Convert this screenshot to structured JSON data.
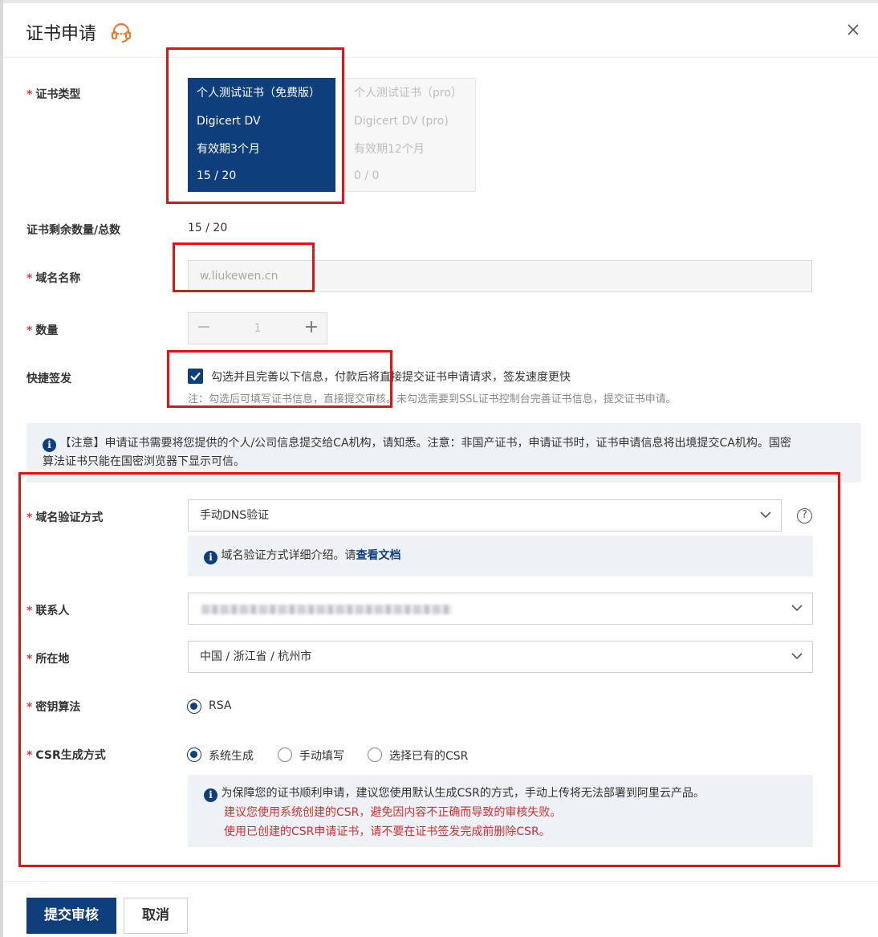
{
  "dialog": {
    "title": "证书申请"
  },
  "labels": {
    "cert_type": "证书类型",
    "remaining": "证书剩余数量/总数",
    "domain": "域名名称",
    "quantity": "数量",
    "quick_issue": "快捷签发",
    "verify_method": "域名验证方式",
    "contact": "联系人",
    "location": "所在地",
    "key_algo": "密钥算法",
    "csr_method": "CSR生成方式"
  },
  "required_mark": "*",
  "cert_cards": [
    {
      "name": "个人测试证书（免费版）",
      "brand": "Digicert DV",
      "validity": "有效期3个月",
      "count": "15 / 20",
      "selected": true
    },
    {
      "name": "个人测试证书（pro）",
      "brand": "Digicert DV (pro)",
      "validity": "有效期12个月",
      "count": "0 / 0",
      "selected": false
    }
  ],
  "remaining_value": "15 / 20",
  "domain_value": "w.liukewen.cn",
  "quantity": {
    "minus": "−",
    "value": "1",
    "plus": "+"
  },
  "quick_issue": {
    "checked": true,
    "text": "勾选并且完善以下信息，付款后将直接提交证书申请请求，签发速度更快",
    "note": "注：勾选后可填写证书信息，直接提交审核。未勾选需要到SSL证书控制台完善证书信息，提交证书申请。"
  },
  "notice": {
    "icon": "info-icon",
    "line1": "【注意】申请证书需要将您提供的个人/公司信息提交给CA机构，请知悉。注意：非国产证书，申请证书时，证书申请信息将出境提交CA机构。国密",
    "line2": "算法证书只能在国密浏览器下显示可信。"
  },
  "verify": {
    "value": "手动DNS验证",
    "help": "?",
    "hint_prefix": "域名验证方式详细介绍。请",
    "hint_link": "查看文档"
  },
  "location_value": "中国 / 浙江省 / 杭州市",
  "key_algo_option": "RSA",
  "csr_options": [
    {
      "label": "系统生成",
      "selected": true
    },
    {
      "label": "手动填写",
      "selected": false
    },
    {
      "label": "选择已有的CSR",
      "selected": false
    }
  ],
  "csr_hint": {
    "line1": "为保障您的证书顺利申请，建议您使用默认生成CSR的方式，手动上传将无法部署到阿里云产品。",
    "line2": "建议您使用系统创建的CSR，避免因内容不正确而导致的审核失败。",
    "line3": "使用已创建的CSR申请证书，请不要在证书签发完成前删除CSR。"
  },
  "footer": {
    "submit": "提交审核",
    "cancel": "取消"
  },
  "colors": {
    "accent": "#0f3e7c",
    "annotation": "#e8110f",
    "warning_text": "#d9302c"
  }
}
